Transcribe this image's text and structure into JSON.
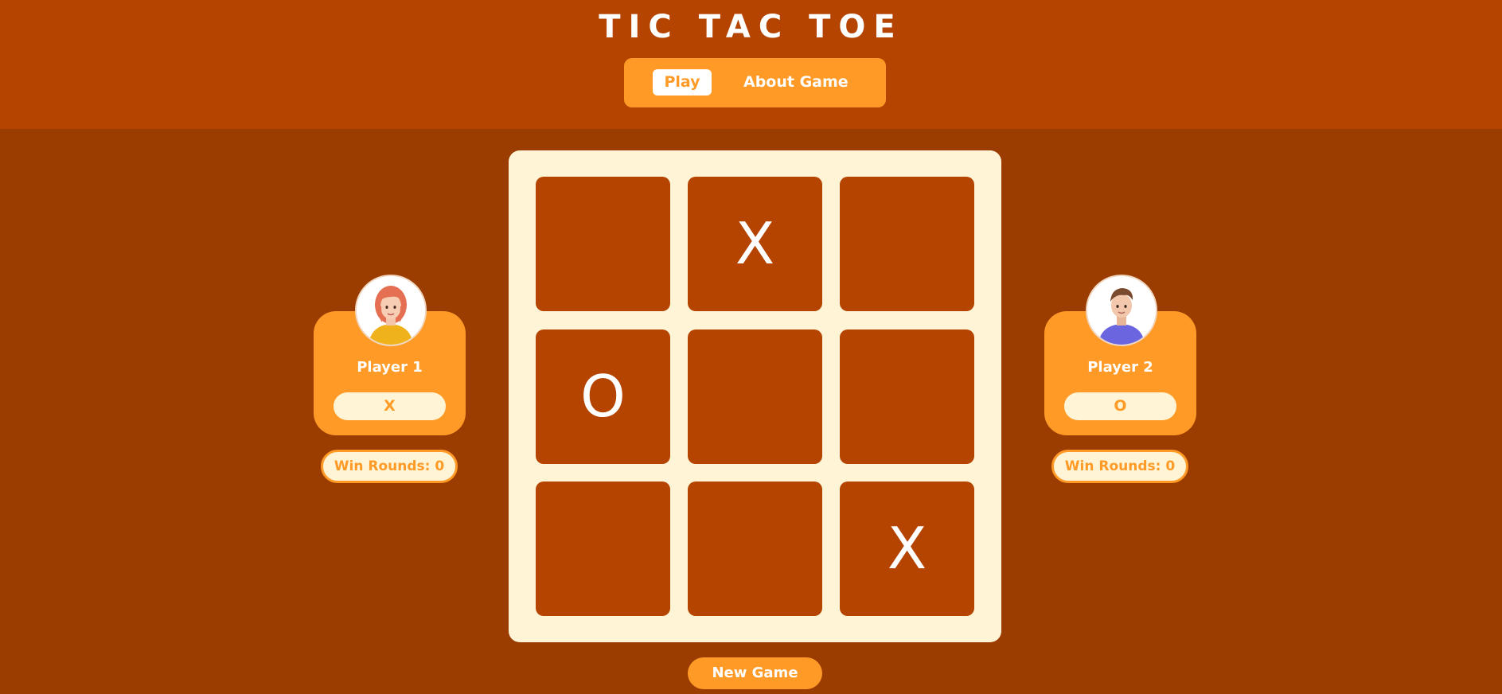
{
  "header": {
    "title": "TIC TAC TOE",
    "nav": {
      "play_label": "Play",
      "about_label": "About Game",
      "active": "Play"
    }
  },
  "board": {
    "cells": [
      "",
      "X",
      "",
      "O",
      "",
      "",
      "",
      "",
      "X"
    ]
  },
  "players": {
    "player1": {
      "name": "Player 1",
      "symbol": "X",
      "win_rounds": "Win Rounds: 0",
      "avatar_icon": "woman-avatar-icon"
    },
    "player2": {
      "name": "Player 2",
      "symbol": "O",
      "win_rounds": "Win Rounds: 0",
      "avatar_icon": "man-avatar-icon"
    }
  },
  "actions": {
    "new_game_label": "New Game"
  },
  "colors": {
    "header_bg": "#b44400",
    "page_bg": "#9b3c00",
    "accent": "#ff9a26",
    "board_bg": "#fff5d6",
    "cell_bg": "#b44400",
    "text_light": "#ffffff"
  }
}
